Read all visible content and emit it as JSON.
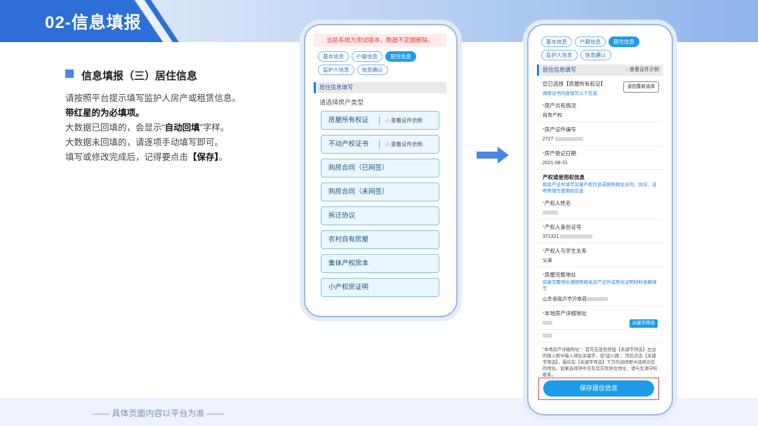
{
  "header": {
    "title": "02-信息填报"
  },
  "section": {
    "title": "信息填报（三）居住信息",
    "instructions": [
      "请按照平台提示填写监护人房产或租赁信息。",
      "带红星的为必填项。",
      "大数据已回填的，会显示“",
      "自动回填",
      "”字样。",
      "大数据未回填的，请逐项手动填写即可。",
      "填写或修改完成后，记得要点击",
      "【保存】",
      "。"
    ]
  },
  "footer": {
    "note": "—— 具体页面内容以平台为准 ——"
  },
  "phone1": {
    "notice": "当前系统为测试版本，数据不定期删除。",
    "tabs": [
      "基本信息",
      "户籍信息",
      "居住信息",
      "监护人信息",
      "信息确认"
    ],
    "active_tab": "居住信息",
    "section_header": "居住信息填写",
    "prompt": "请选择房产类型",
    "example_label": "查看证件示例",
    "options": [
      "房屋所有权证",
      "不动产权证书",
      "购房合同（已网签）",
      "购房合同（未网签）",
      "拆迁协议",
      "农村自有房屋",
      "集体产权房本",
      "小产权房证明"
    ]
  },
  "phone2": {
    "tabs": [
      "基本信息",
      "户籍信息",
      "居住信息",
      "监护人信息",
      "信息确认"
    ],
    "active_tab": "居住信息",
    "section_header": "居住信息填写",
    "header_example": "查看证件示例",
    "selected_label": "您已选择【房屋所有权证】",
    "selected_hint": "请按证书内容填写以下信息",
    "reselect_button": "返回重新选择",
    "fields": {
      "co_ownership_label": "房产共有情况",
      "co_ownership_value": "自有产权",
      "cert_no_label": "房产证件编号",
      "cert_no_value": "2727",
      "reg_date_label": "房产登记日期",
      "reg_date_value": "2021-08-31",
      "owner_section_title": "产权或使用权信息",
      "owner_section_hint": "按房产证件填写房屋产权信息或按照相关合同、协议、证明等填写使用权信息",
      "owner_name_label": "产权人姓名",
      "owner_id_label": "产权人身份证号",
      "owner_id_value": "371321",
      "relation_label": "产权人与学生关系",
      "relation_value": "父亲",
      "address_label": "房屋完整地址",
      "address_hint": "房屋完整地址请按照相关房产证件或居住证明材料准确填写",
      "address_value": "山东省临沂市沂南县",
      "detail_address_label": "本地房产详细地址",
      "keyword_button": "关键字筛选"
    },
    "note": "“本地房产详细地址”：首先在蓝色按钮【关键字筛选】左边的输入框中输入地址关键字，如“延川路”，然后点击【关键字筛选】，最后在【关键字筛选】下方的选择框中选择对应的地址。如果选择项中没有您实际居住地址，请与生源学校联系。",
    "save_button": "保存居住信息"
  },
  "colors": {
    "primary": "#2d6fd6",
    "accent": "#1e9be8",
    "required": "#e03a3a",
    "highlight_box": "#e5485a"
  }
}
